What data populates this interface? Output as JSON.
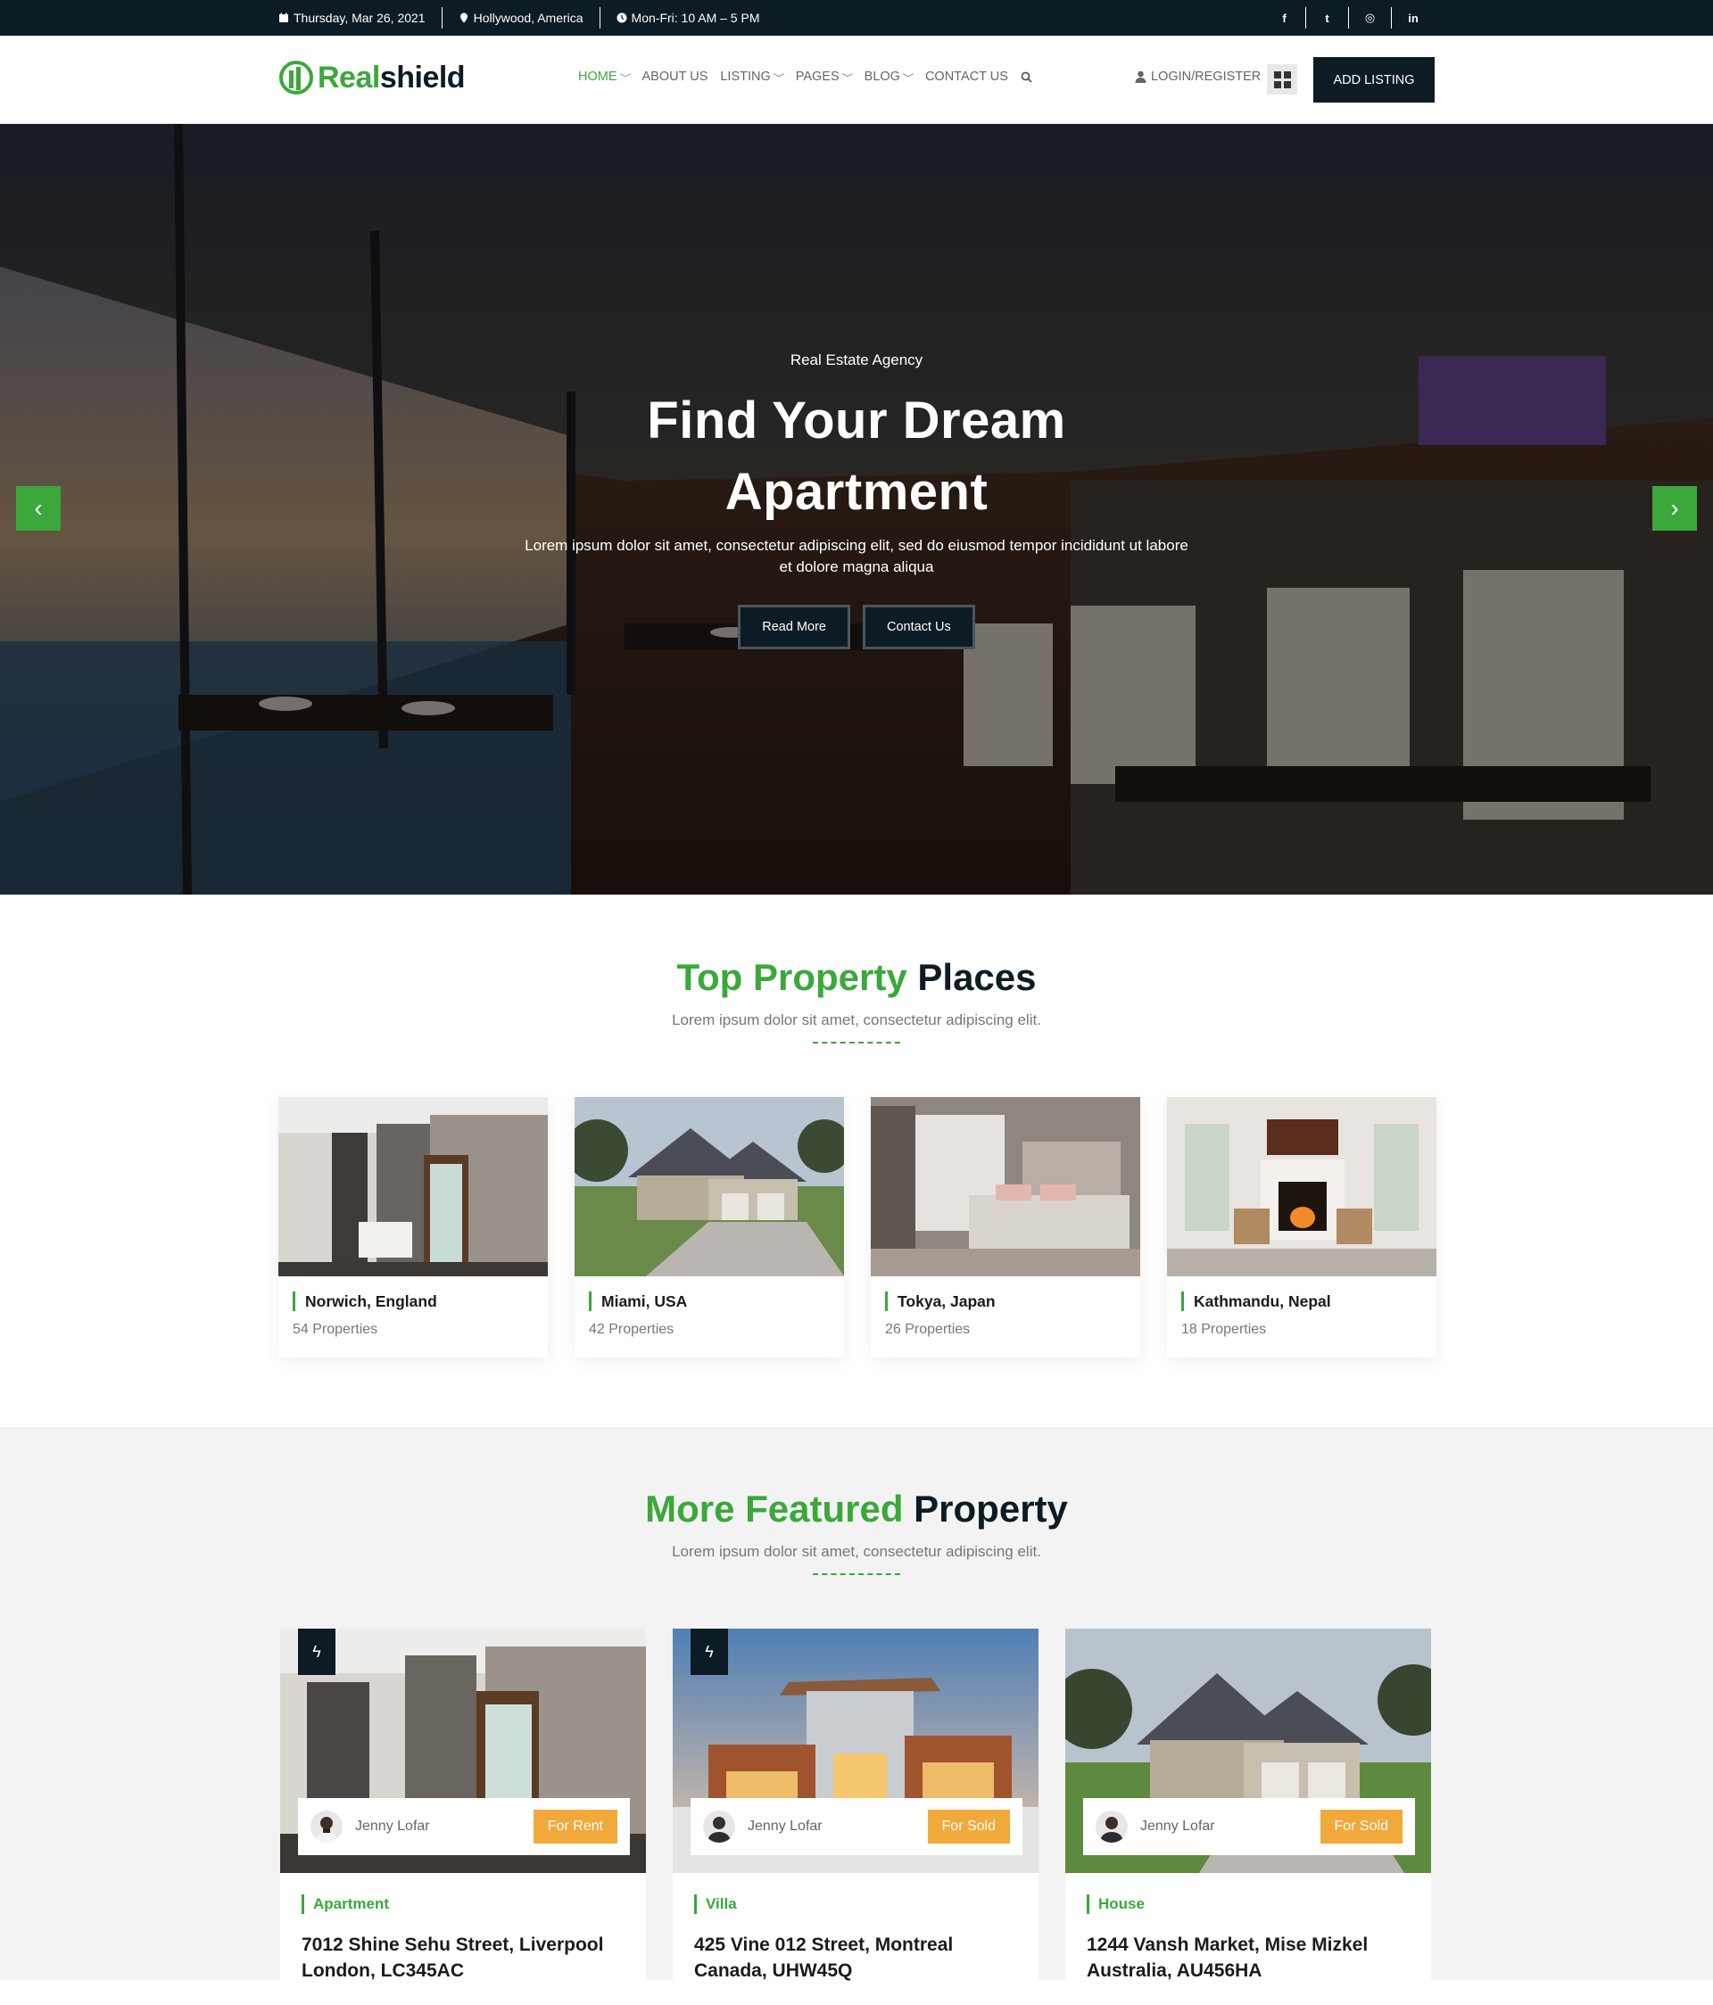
{
  "topbar": {
    "date": "Thursday, Mar 26, 2021",
    "location": "Hollywood, America",
    "hours": "Mon-Fri: 10 AM – 5 PM",
    "social": [
      {
        "icon": "facebook-icon",
        "glyph": "f"
      },
      {
        "icon": "twitter-icon",
        "glyph": "t"
      },
      {
        "icon": "instagram-icon",
        "glyph": "◎"
      },
      {
        "icon": "linkedin-icon",
        "glyph": "in"
      }
    ]
  },
  "header": {
    "logo_part1": "Real",
    "logo_part2": "shield",
    "nav": [
      {
        "label": "HOME",
        "dropdown": true,
        "active": true
      },
      {
        "label": "ABOUT US",
        "dropdown": false,
        "active": false
      },
      {
        "label": "LISTING",
        "dropdown": true,
        "active": false
      },
      {
        "label": "PAGES",
        "dropdown": true,
        "active": false
      },
      {
        "label": "BLOG",
        "dropdown": true,
        "active": false
      },
      {
        "label": "CONTACT US",
        "dropdown": false,
        "active": false
      }
    ],
    "login": "LOGIN/REGISTER",
    "add_listing": "ADD LISTING"
  },
  "hero": {
    "eyebrow": "Real Estate Agency",
    "title_line1": "Find Your Dream",
    "title_line2": "Apartment",
    "text": "Lorem ipsum dolor sit amet, consectetur adipiscing elit, sed do eiusmod tempor incididunt ut labore et dolore magna aliqua",
    "btn_primary": "Read More",
    "btn_secondary": "Contact Us",
    "prev": "‹",
    "next": "›"
  },
  "places_section": {
    "title_green": "Top Property",
    "title_dark": "Places",
    "subtitle": "Lorem ipsum dolor sit amet, consectetur adipiscing elit.",
    "places": [
      {
        "name": "Norwich, England",
        "count": "54 Properties",
        "scene": "interior"
      },
      {
        "name": "Miami, USA",
        "count": "42 Properties",
        "scene": "house"
      },
      {
        "name": "Tokya, Japan",
        "count": "26 Properties",
        "scene": "bedroom"
      },
      {
        "name": "Kathmandu, Nepal",
        "count": "18 Properties",
        "scene": "living"
      }
    ]
  },
  "featured_section": {
    "title_green": "More Featured",
    "title_dark": "Property",
    "subtitle": "Lorem ipsum dolor sit amet, consectetur adipiscing elit.",
    "cards": [
      {
        "agent": "Jenny Lofar",
        "status": "For Rent",
        "type": "Apartment",
        "address": "7012 Shine Sehu Street, Liverpool London, LC345AC",
        "scene": "interior"
      },
      {
        "agent": "Jenny Lofar",
        "status": "For Sold",
        "type": "Villa",
        "address": "425 Vine 012 Street, Montreal Canada, UHW45Q",
        "scene": "villa"
      },
      {
        "agent": "Jenny Lofar",
        "status": "For Sold",
        "type": "House",
        "address": "1244 Vansh Market, Mise Mizkel Australia, AU456HA",
        "scene": "house"
      }
    ]
  },
  "colors": {
    "brand_green": "#3aa83a",
    "dark": "#0d1b24",
    "status_orange": "#f2a93b"
  }
}
